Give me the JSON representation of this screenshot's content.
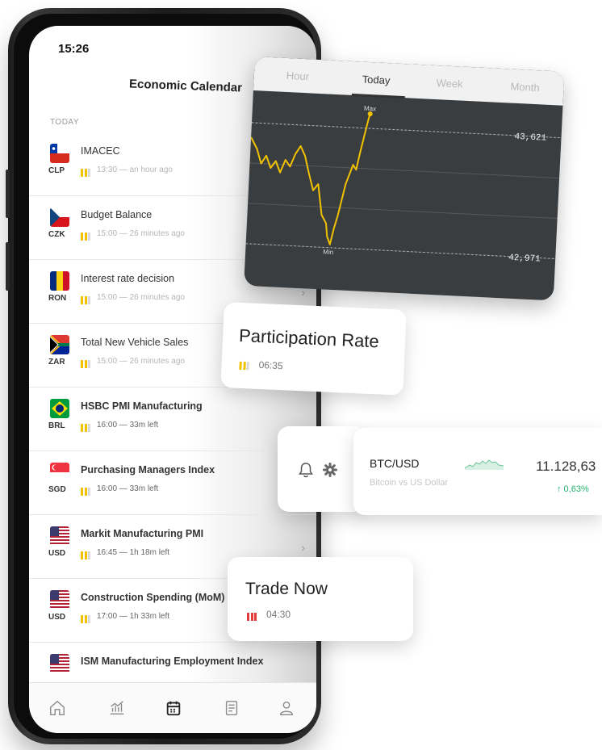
{
  "status_bar": {
    "time": "15:26"
  },
  "header": {
    "title": "Economic Calendar"
  },
  "section_label": "TODAY",
  "events": [
    {
      "name": "IMACEC",
      "currency": "CLP",
      "time": "13:30 — an hour ago",
      "flag": "cl",
      "level": 3,
      "faded": true,
      "bold": false
    },
    {
      "name": "Budget Balance",
      "currency": "CZK",
      "time": "15:00 — 26 minutes ago",
      "flag": "cz",
      "level": 3,
      "faded": true,
      "bold": false
    },
    {
      "name": "Interest rate decision",
      "currency": "RON",
      "time": "15:00 — 26 minutes ago",
      "flag": "ro",
      "level": 3,
      "faded": true,
      "bold": false
    },
    {
      "name": "Total New Vehicle Sales",
      "currency": "ZAR",
      "time": "15:00 — 26 minutes ago",
      "flag": "za",
      "level": 3,
      "faded": true,
      "bold": false
    },
    {
      "name": "HSBC PMI Manufacturing",
      "currency": "BRL",
      "time": "16:00 — 33m left",
      "flag": "br",
      "level": 3,
      "faded": false,
      "bold": true
    },
    {
      "name": "Purchasing Managers Index",
      "currency": "SGD",
      "time": "16:00 — 33m left",
      "flag": "sg",
      "level": 3,
      "faded": false,
      "bold": true
    },
    {
      "name": "Markit Manufacturing PMI",
      "currency": "USD",
      "time": "16:45 — 1h 18m left",
      "flag": "us",
      "level": 3,
      "faded": false,
      "bold": true
    },
    {
      "name": "Construction Spending (MoM)",
      "currency": "USD",
      "time": "17:00 — 1h 33m left",
      "flag": "us",
      "level": 3,
      "faded": false,
      "bold": true
    },
    {
      "name": "ISM Manufacturing Employment Index",
      "currency": "",
      "time": "",
      "flag": "us",
      "level": 0,
      "faded": false,
      "bold": true
    }
  ],
  "tabbar": {
    "icons": [
      "home-icon",
      "chart-icon",
      "calendar-icon",
      "news-icon",
      "profile-icon"
    ],
    "active": "calendar-icon"
  },
  "chart_card": {
    "tabs": [
      "Hour",
      "Today",
      "Week",
      "Month"
    ],
    "active_tab": "Today",
    "max_label": "Max",
    "min_label": "Min",
    "upper_price": "43,621",
    "lower_price": "42,971",
    "line_color": "#f2c200",
    "background": "#3a3d40"
  },
  "participation_card": {
    "title": "Participation Rate",
    "time": "06:35",
    "bar_color": "#f2c200"
  },
  "ticker_card": {
    "pair": "BTC/USD",
    "description": "Bitcoin vs US Dollar",
    "price": "11.128,63",
    "change": "↑ 0,63%",
    "change_color": "#23b26d",
    "icons": [
      "bell-icon",
      "gear-icon"
    ]
  },
  "trade_card": {
    "title": "Trade Now",
    "time": "04:30",
    "bar_color": "#e23b3b"
  }
}
